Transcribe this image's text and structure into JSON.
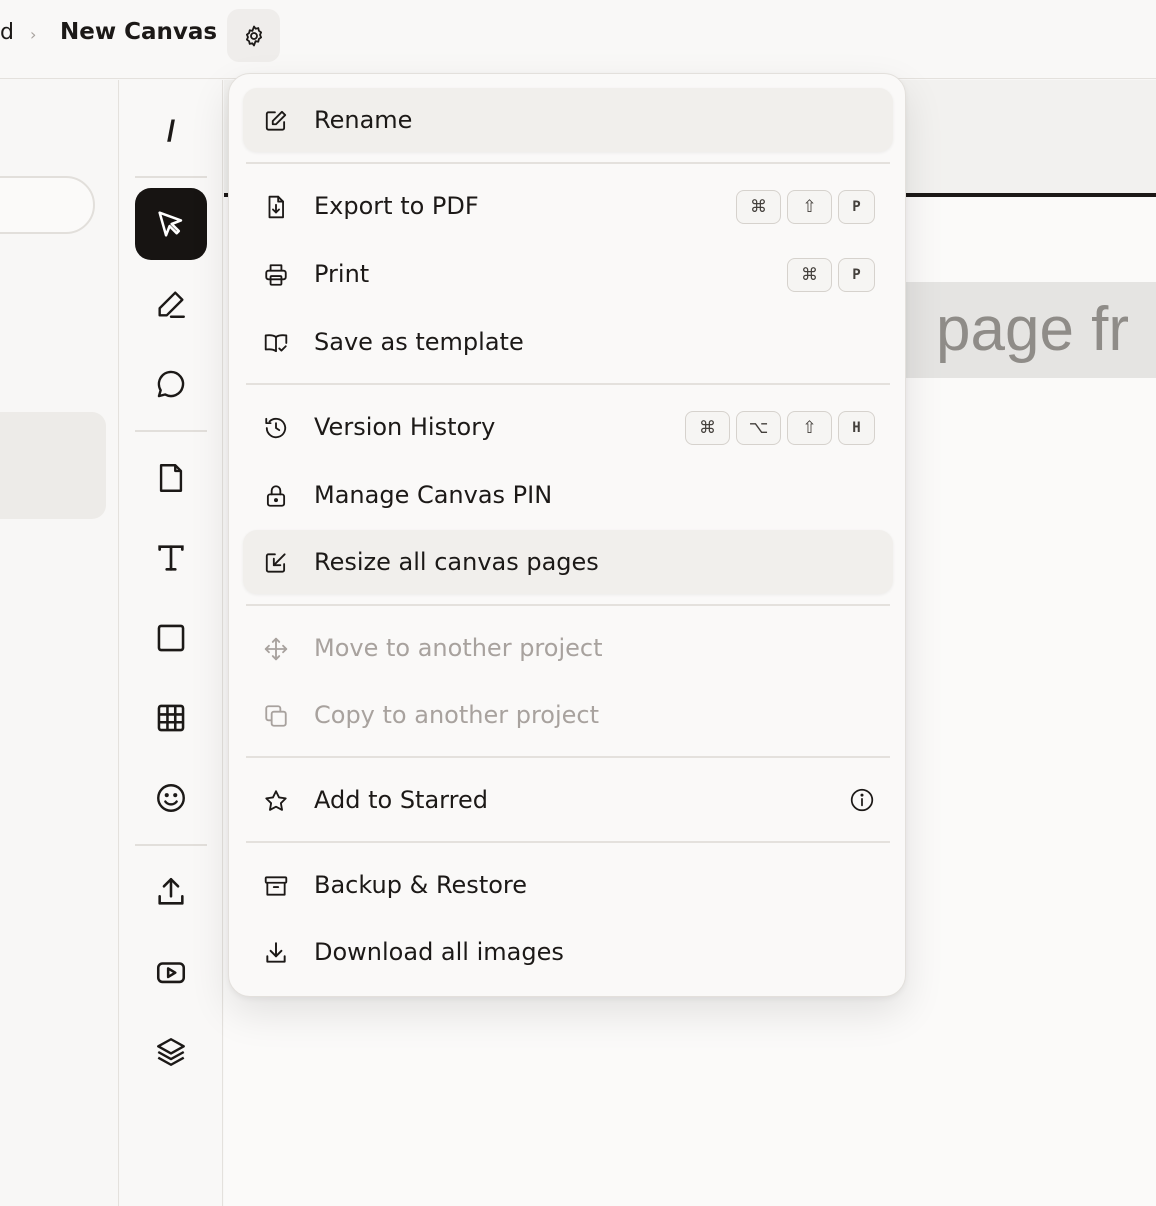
{
  "header": {
    "breadcrumb_prev": "d",
    "breadcrumb_sep": "›",
    "breadcrumb_current": "New Canvas"
  },
  "toolbar": {
    "slash_label": "/"
  },
  "canvas": {
    "page_label": "page fr"
  },
  "menu": {
    "items": [
      {
        "label": "Rename",
        "icon": "edit-icon"
      },
      {
        "label": "Export to PDF",
        "icon": "file-download-icon",
        "shortcut": [
          "⌘",
          "⇧",
          "P"
        ]
      },
      {
        "label": "Print",
        "icon": "printer-icon",
        "shortcut": [
          "⌘",
          "P"
        ]
      },
      {
        "label": "Save as template",
        "icon": "book-check-icon"
      },
      {
        "label": "Version History",
        "icon": "history-icon",
        "shortcut": [
          "⌘",
          "⌥",
          "⇧",
          "H"
        ]
      },
      {
        "label": "Manage Canvas PIN",
        "icon": "lock-icon"
      },
      {
        "label": "Resize all canvas pages",
        "icon": "resize-icon"
      },
      {
        "label": "Move to another project",
        "icon": "move-icon",
        "disabled": true
      },
      {
        "label": "Copy to another project",
        "icon": "copy-icon",
        "disabled": true
      },
      {
        "label": "Add to Starred",
        "icon": "star-icon"
      },
      {
        "label": "Backup & Restore",
        "icon": "archive-icon"
      },
      {
        "label": "Download all images",
        "icon": "download-icon"
      }
    ]
  }
}
